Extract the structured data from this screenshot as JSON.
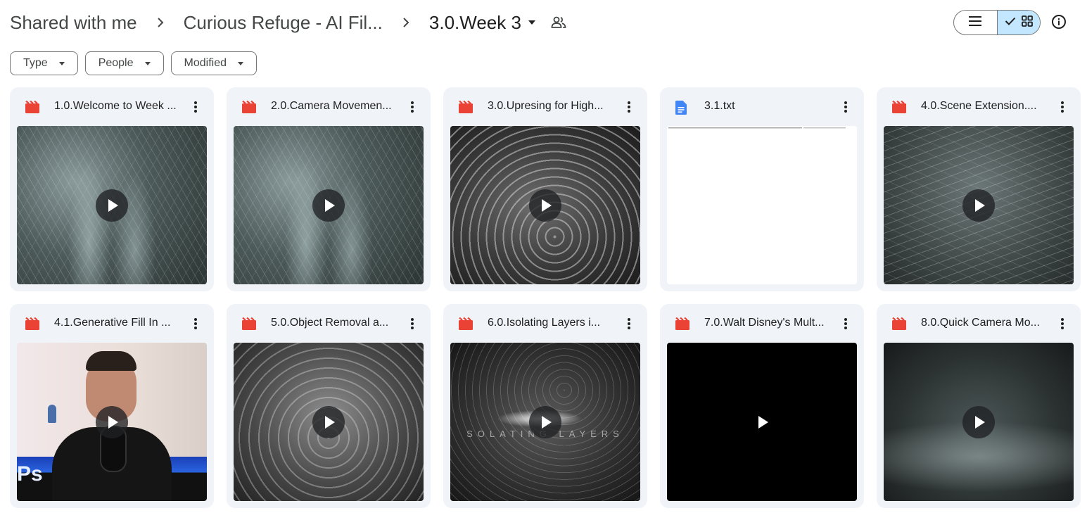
{
  "breadcrumb": {
    "items": [
      "Shared with me",
      "Curious Refuge - AI Fil..."
    ],
    "current": "3.0.Week 3"
  },
  "filters": [
    "Type",
    "People",
    "Modified"
  ],
  "view_toggle": {
    "active": "grid"
  },
  "files": [
    {
      "name": "1.0.Welcome to Week ...",
      "kind": "video",
      "thumb": "streams"
    },
    {
      "name": "2.0.Camera Movemen...",
      "kind": "video",
      "thumb": "streams"
    },
    {
      "name": "3.0.Upresing for High...",
      "kind": "video",
      "thumb": "swirl"
    },
    {
      "name": "3.1.txt",
      "kind": "document",
      "thumb": "doc"
    },
    {
      "name": "4.0.Scene Extension....",
      "kind": "video",
      "thumb": "waves"
    },
    {
      "name": "4.1.Generative Fill In ...",
      "kind": "video",
      "thumb": "person"
    },
    {
      "name": "5.0.Object Removal a...",
      "kind": "video",
      "thumb": "vortex"
    },
    {
      "name": "6.0.Isolating Layers i...",
      "kind": "video",
      "thumb": "isolate"
    },
    {
      "name": "7.0.Walt Disney's Mult...",
      "kind": "video",
      "thumb": "black"
    },
    {
      "name": "8.0.Quick Camera Mo...",
      "kind": "video",
      "thumb": "terrain"
    }
  ],
  "thumb_text": {
    "isolating": "SOLATING LAYERS",
    "ps": "Ps"
  },
  "colors": {
    "video_icon": "#ea4335",
    "doc_icon": "#4285f4",
    "toggle_active": "#c2e7ff",
    "card_bg": "#f0f4f9"
  },
  "icons": {
    "breadcrumb_separator": "chevron-right-icon",
    "shared": "shared-people-icon",
    "list_view": "list-view-icon",
    "grid_view": "grid-view-icon",
    "info": "info-icon",
    "more": "more-vert-icon",
    "video": "video-file-icon",
    "document": "document-file-icon",
    "play": "play-icon"
  }
}
